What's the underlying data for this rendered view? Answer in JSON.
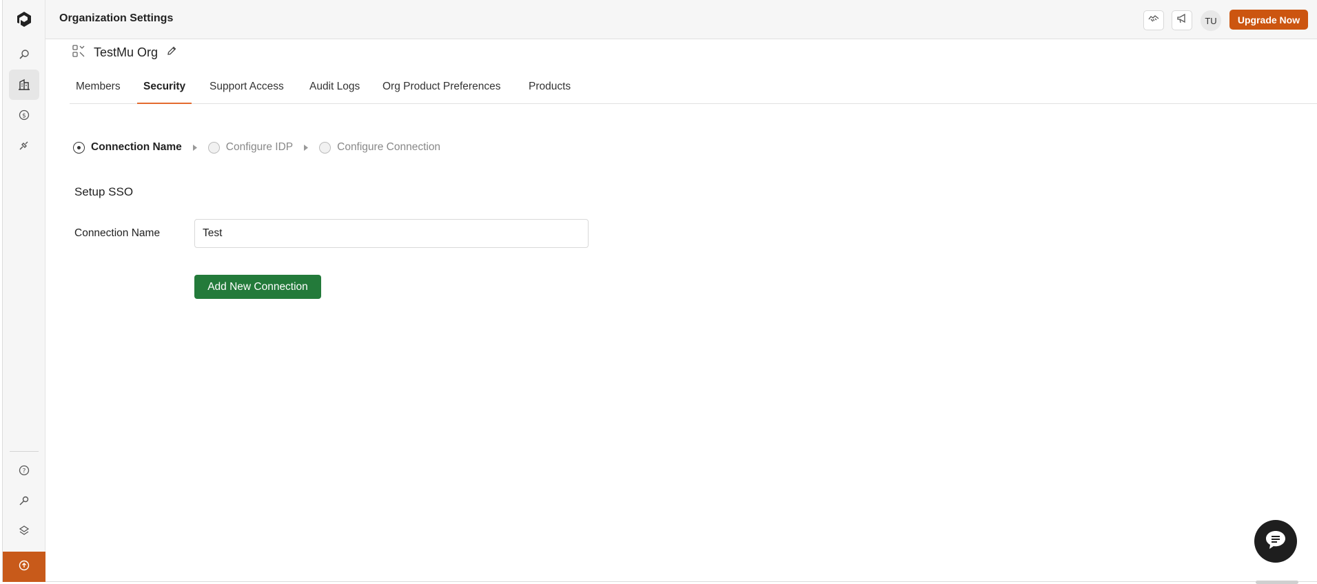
{
  "header": {
    "title": "Organization Settings",
    "avatar_initials": "TU",
    "upgrade_label": "Upgrade Now",
    "icons": [
      "handshake-icon",
      "megaphone-icon"
    ]
  },
  "sidebar": {
    "items": [
      {
        "icon": "logo-icon"
      },
      {
        "icon": "search-icon"
      },
      {
        "icon": "building-icon",
        "active": true
      },
      {
        "icon": "dollar-icon"
      },
      {
        "icon": "plug-icon"
      }
    ],
    "bottom_items": [
      {
        "icon": "help-icon"
      },
      {
        "icon": "key-icon"
      },
      {
        "icon": "layers-icon"
      },
      {
        "icon": "upload-circle-icon"
      }
    ]
  },
  "org": {
    "name": "TestMu Org"
  },
  "tabs": [
    {
      "label": "Members"
    },
    {
      "label": "Security",
      "active": true
    },
    {
      "label": "Support Access"
    },
    {
      "label": "Audit Logs"
    },
    {
      "label": "Org Product Preferences"
    },
    {
      "label": "Products"
    }
  ],
  "stepper": {
    "steps": [
      {
        "label": "Connection Name",
        "state": "active"
      },
      {
        "label": "Configure IDP",
        "state": "pending"
      },
      {
        "label": "Configure Connection",
        "state": "pending"
      }
    ]
  },
  "form": {
    "section_title": "Setup SSO",
    "connection_name_label": "Connection Name",
    "connection_name_value": "Test",
    "submit_label": "Add New Connection"
  },
  "colors": {
    "accent": "#cc5510",
    "tab_underline": "#e46a2e",
    "primary_button": "#237a3a",
    "sidebar_bottom": "#c85a1a"
  }
}
